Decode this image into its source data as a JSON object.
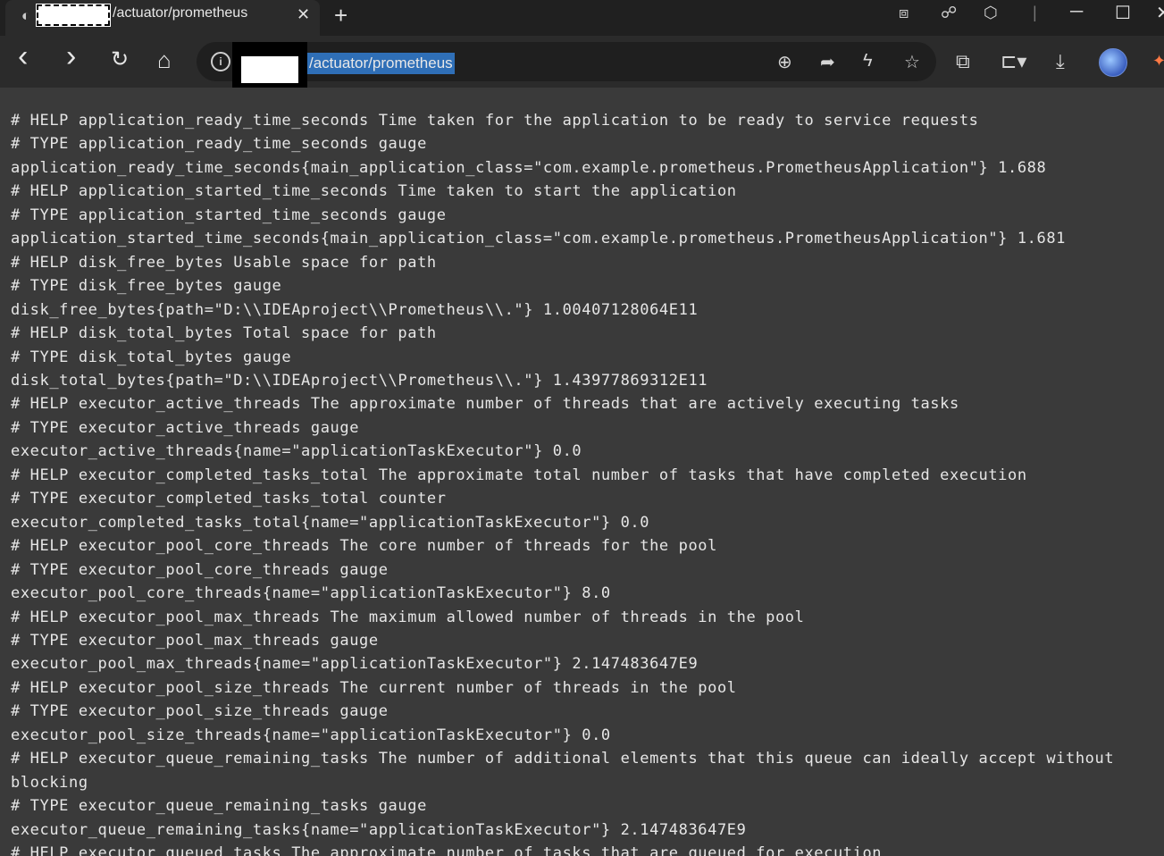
{
  "tab": {
    "favicon": "edge-logo-icon",
    "title": "/actuator/prometheus",
    "close_glyph": "✕",
    "new_tab_glyph": "+"
  },
  "window_controls": {
    "minimize": "─",
    "maximize": "☐",
    "close": "✕"
  },
  "toolbar": {
    "back": "‹",
    "forward": "›",
    "reload": "↻",
    "home": "⌂"
  },
  "address": {
    "url_visible": "/actuator/prometheus"
  },
  "content": {
    "lines": [
      "# HELP application_ready_time_seconds Time taken for the application to be ready to service requests",
      "# TYPE application_ready_time_seconds gauge",
      "application_ready_time_seconds{main_application_class=\"com.example.prometheus.PrometheusApplication\"} 1.688",
      "# HELP application_started_time_seconds Time taken to start the application",
      "# TYPE application_started_time_seconds gauge",
      "application_started_time_seconds{main_application_class=\"com.example.prometheus.PrometheusApplication\"} 1.681",
      "# HELP disk_free_bytes Usable space for path",
      "# TYPE disk_free_bytes gauge",
      "disk_free_bytes{path=\"D:\\\\IDEAproject\\\\Prometheus\\\\.\"} 1.00407128064E11",
      "# HELP disk_total_bytes Total space for path",
      "# TYPE disk_total_bytes gauge",
      "disk_total_bytes{path=\"D:\\\\IDEAproject\\\\Prometheus\\\\.\"} 1.43977869312E11",
      "# HELP executor_active_threads The approximate number of threads that are actively executing tasks",
      "# TYPE executor_active_threads gauge",
      "executor_active_threads{name=\"applicationTaskExecutor\"} 0.0",
      "# HELP executor_completed_tasks_total The approximate total number of tasks that have completed execution",
      "# TYPE executor_completed_tasks_total counter",
      "executor_completed_tasks_total{name=\"applicationTaskExecutor\"} 0.0",
      "# HELP executor_pool_core_threads The core number of threads for the pool",
      "# TYPE executor_pool_core_threads gauge",
      "executor_pool_core_threads{name=\"applicationTaskExecutor\"} 8.0",
      "# HELP executor_pool_max_threads The maximum allowed number of threads in the pool",
      "# TYPE executor_pool_max_threads gauge",
      "executor_pool_max_threads{name=\"applicationTaskExecutor\"} 2.147483647E9",
      "# HELP executor_pool_size_threads The current number of threads in the pool",
      "# TYPE executor_pool_size_threads gauge",
      "executor_pool_size_threads{name=\"applicationTaskExecutor\"} 0.0",
      "# HELP executor_queue_remaining_tasks The number of additional elements that this queue can ideally accept without blocking",
      "# TYPE executor_queue_remaining_tasks gauge",
      "executor_queue_remaining_tasks{name=\"applicationTaskExecutor\"} 2.147483647E9",
      "# HELP executor_queued_tasks The approximate number of tasks that are queued for execution"
    ]
  }
}
